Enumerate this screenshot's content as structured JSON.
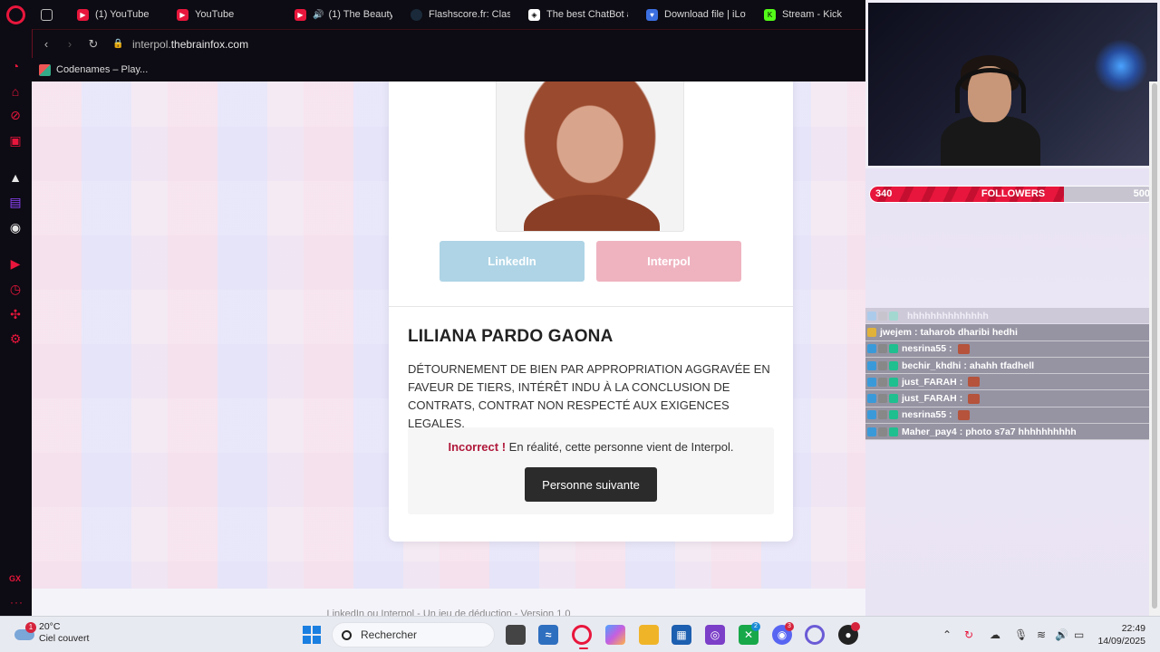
{
  "browser": {
    "tabs": [
      {
        "label": "(1) YouTube",
        "icon": "youtube-icon",
        "color": "#e8163c"
      },
      {
        "label": "YouTube",
        "icon": "youtube-icon",
        "color": "#e8163c"
      },
      {
        "label": "(1) The Beauty",
        "icon": "youtube-icon",
        "color": "#e8163c"
      },
      {
        "label": "Flashscore.fr: Clas",
        "icon": "flashscore-icon",
        "color": "#1a2a3a"
      },
      {
        "label": "The best ChatBot a",
        "icon": "chatbot-icon",
        "color": "#555"
      },
      {
        "label": "Download file | iLov",
        "icon": "heart-icon",
        "color": "#3b6fe0"
      },
      {
        "label": "Stream - Kick Da",
        "icon": "kick-icon",
        "color": "#53fc18"
      }
    ],
    "url_prefix": "interpol.",
    "url_domain": "thebrainfox.com",
    "bookmark": "Codenames – Play..."
  },
  "card": {
    "linkedin_label": "LinkedIn",
    "interpol_label": "Interpol",
    "person_name": "LILIANA PARDO GAONA",
    "charges": "DÉTOURNEMENT DE BIEN PAR APPROPRIATION AGGRAVÉE EN FAVEUR DE TIERS, INTÉRÊT INDU À LA CONCLUSION DE CONTRATS, CONTRAT NON RESPECTÉ AUX EXIGENCES LEGALES.",
    "result_status": "Incorrect !",
    "result_message": " En réalité, cette personne vient de Interpol.",
    "next_button": "Personne suivante",
    "footer": "LinkedIn ou Interpol - Un jeu de déduction - Version 1.0"
  },
  "stream": {
    "followers_current": "340",
    "followers_label": "FOLLOWERS",
    "followers_goal": "500",
    "followers_progress": 0.68,
    "chat": [
      {
        "user": "",
        "message": "hhhhhhhhhhhhhh",
        "faded": true
      },
      {
        "user": "jwejem",
        "message": "taharob dharibi hedhi",
        "badge": "gold"
      },
      {
        "user": "nesrina55",
        "message": "",
        "emote": true
      },
      {
        "user": "bechir_khdhi",
        "message": "ahahh tfadhell"
      },
      {
        "user": "just_FARAH",
        "message": "",
        "emote": true
      },
      {
        "user": "just_FARAH",
        "message": "",
        "emote": true
      },
      {
        "user": "nesrina55",
        "message": "",
        "emote": true
      },
      {
        "user": "Maher_pay4",
        "message": "photo s7a7 hhhhhhhhhh"
      }
    ]
  },
  "taskbar": {
    "temperature": "20°C",
    "weather": "Ciel couvert",
    "weather_badge": "1",
    "search_placeholder": "Rechercher",
    "time": "22:49",
    "date": "14/09/2025",
    "discord_badge": "3",
    "xbox_badge": "2"
  }
}
